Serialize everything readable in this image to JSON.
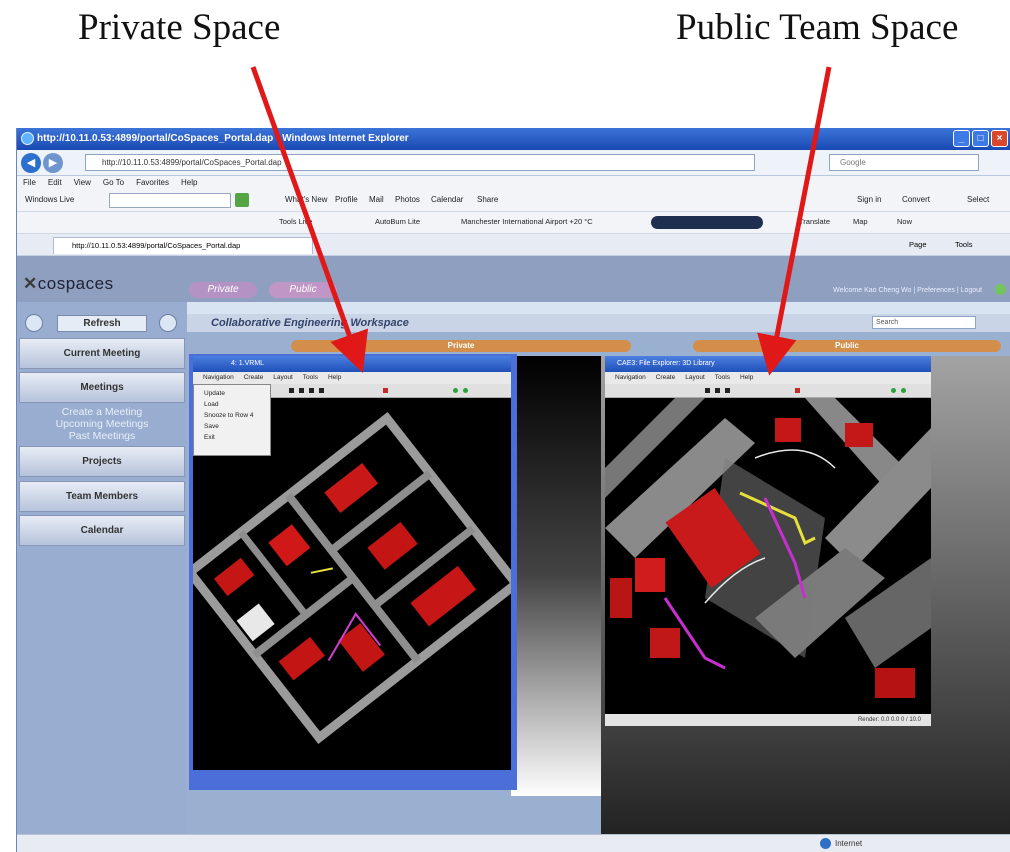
{
  "captions": {
    "private": "Private Space",
    "public": "Public Team Space"
  },
  "browser": {
    "title": "http://10.11.0.53:4899/portal/CoSpaces_Portal.dap - Windows Internet Explorer",
    "url": "http://10.11.0.53:4899/portal/CoSpaces_Portal.dap",
    "search_placeholder": "Google",
    "menu": [
      "File",
      "Edit",
      "View",
      "Go To",
      "Favorites",
      "Help"
    ],
    "links_left": "Windows Live",
    "links_items": [
      "What's New",
      "Profile",
      "Mail",
      "Photos",
      "Calendar",
      "Share"
    ],
    "links_right": [
      "Sign in",
      "Convert",
      "Select"
    ],
    "fav_items": [
      "Tools Live",
      "AutoBum Lite",
      "Manchester International Airport +20 °C"
    ],
    "fav_right": [
      "Translate",
      "Map",
      "Now"
    ],
    "tab_title": "http://10.11.0.53:4899/portal/CoSpaces_Portal.dap",
    "tab_right": [
      "Page",
      "Tools"
    ],
    "status_zone": "Internet"
  },
  "portal": {
    "logo": "cospaces",
    "top_tabs": [
      "Private",
      "Public"
    ],
    "header_right": "Welcome Kao Cheng Wo | Preferences | Logout",
    "breadcrumb": "Collaborative Engineering Workspace",
    "search_placeholder": "Search",
    "refresh_label": "Refresh",
    "sidebar": {
      "current_meeting": "Current Meeting",
      "meetings": "Meetings",
      "sub_links": [
        "Create a Meeting",
        "Upcoming Meetings",
        "Past Meetings"
      ],
      "projects": "Projects",
      "team_members": "Team Members",
      "calendar": "Calendar"
    },
    "area_labels": {
      "private": "Private",
      "public": "Public"
    }
  },
  "private_app": {
    "title": "4: 1.VRML",
    "menu": [
      "Navigation",
      "Create",
      "Layout",
      "Tools",
      "Help"
    ],
    "context_menu": [
      "Update",
      "Load",
      "Snooze to Row 4",
      "Save",
      "Exit"
    ]
  },
  "public_app": {
    "title": "CAE3: File Explorer: 3D Library",
    "menu": [
      "Navigation",
      "Create",
      "Layout",
      "Tools",
      "Help"
    ],
    "status": "Render: 0.0 0.0 0 / 10.0"
  },
  "colors": {
    "arrow": "#e01818",
    "ie_title": "#1a49b4",
    "portal_bg": "#98adcf",
    "area_label": "#d28e4a"
  }
}
